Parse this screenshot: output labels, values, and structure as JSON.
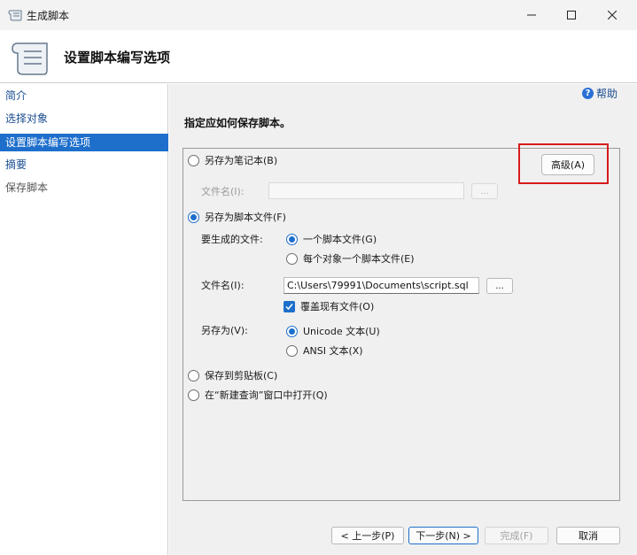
{
  "window": {
    "title": "生成脚本"
  },
  "header": {
    "title": "设置脚本编写选项"
  },
  "sidebar": {
    "items": [
      {
        "label": "简介"
      },
      {
        "label": "选择对象"
      },
      {
        "label": "设置脚本编写选项"
      },
      {
        "label": "摘要"
      },
      {
        "label": "保存脚本"
      }
    ]
  },
  "help": {
    "label": "帮助"
  },
  "instruction": "指定应如何保存脚本。",
  "options": {
    "notebook": {
      "label": "另存为笔记本(B)",
      "filename_label": "文件名(I):",
      "browse_label": "..."
    },
    "advanced_label": "高级(A)",
    "script_file": {
      "label": "另存为脚本文件(F)",
      "files_label": "要生成的文件:",
      "single_file": "一个脚本文件(G)",
      "per_object": "每个对象一个脚本文件(E)",
      "filename_label": "文件名(I):",
      "filename_value": "C:\\Users\\79991\\Documents\\script.sql",
      "browse_label": "...",
      "overwrite_label": "覆盖现有文件(O)",
      "save_as_label": "另存为(V):",
      "unicode": "Unicode 文本(U)",
      "ansi": "ANSI 文本(X)"
    },
    "clipboard": "保存到剪贴板(C)",
    "new_query": "在“新建查询”窗口中打开(Q)"
  },
  "footer": {
    "prev": "< 上一步(P)",
    "next": "下一步(N) >",
    "finish": "完成(F)",
    "cancel": "取消"
  },
  "colors": {
    "accent": "#1e6fcc",
    "highlight": "#d81b1b"
  }
}
